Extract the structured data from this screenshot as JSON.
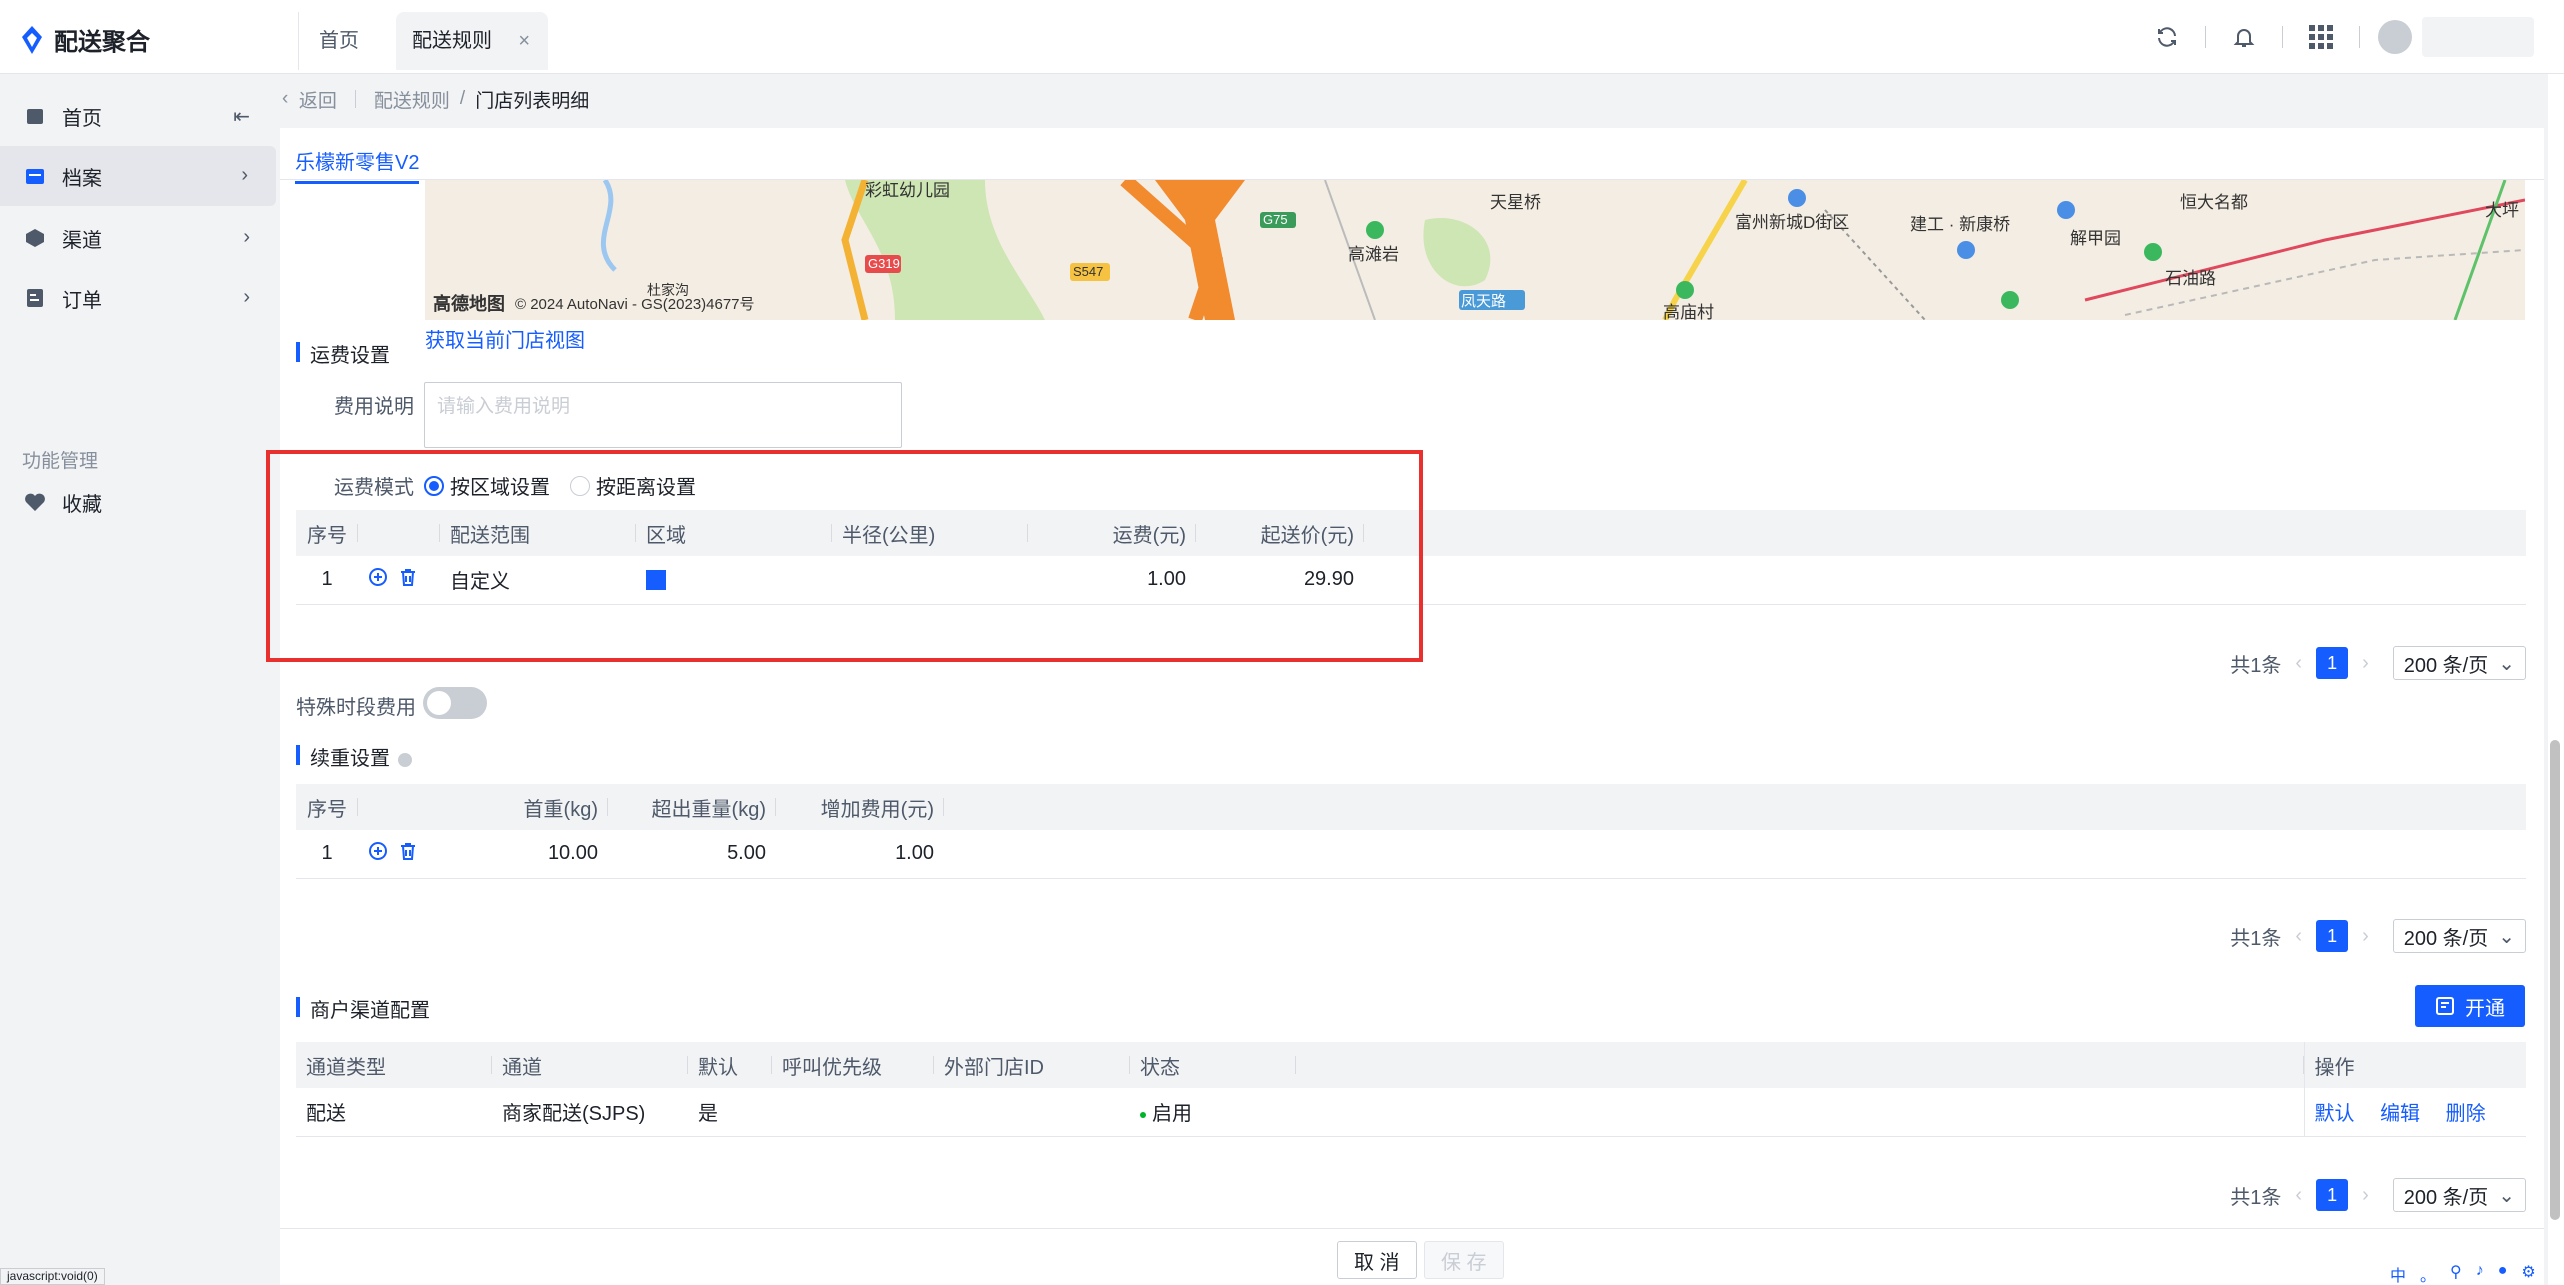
{
  "app": {
    "name": "配送聚合"
  },
  "tabs": {
    "home": "首页",
    "rules": "配送规则",
    "close": "×"
  },
  "sidebar": {
    "items": [
      {
        "label": "首页",
        "collapse": "⇤"
      },
      {
        "label": "档案",
        "arrow": "›"
      },
      {
        "label": "渠道",
        "arrow": "›"
      },
      {
        "label": "订单",
        "arrow": "›"
      }
    ],
    "section": "功能管理",
    "favorites": "收藏"
  },
  "breadcrumb": {
    "back": "返回",
    "parent": "配送规则",
    "slash": "/",
    "current": "门店列表明细"
  },
  "store_tab": "乐檬新零售V2",
  "map": {
    "brand": "高德地图",
    "copyright": "© 2024 AutoNavi - GS(2023)4677号",
    "labels": [
      "彩虹幼儿园",
      "天星桥",
      "富州新城D街区",
      "建工 · 新康桥",
      "恒大名都",
      "大坪",
      "高滩岩",
      "解甲园",
      "石油路",
      "杜家沟",
      "凤天路",
      "高庙村",
      "G319",
      "G75",
      "S547"
    ]
  },
  "view_link": "获取当前门店视图",
  "freight": {
    "title": "运费设置",
    "desc_label": "费用说明",
    "desc_placeholder": "请输入费用说明",
    "mode_label": "运费模式",
    "mode_area": "按区域设置",
    "mode_distance": "按距离设置",
    "columns": [
      "序号",
      "配送范围",
      "区域",
      "半径(公里)",
      "运费(元)",
      "起送价(元)"
    ],
    "rows": [
      {
        "no": "1",
        "range": "自定义",
        "radius": "",
        "fee": "1.00",
        "min": "29.90"
      }
    ],
    "zone_color": "#165dff"
  },
  "pager1": {
    "total": "共1条",
    "page": "1",
    "size": "200 条/页"
  },
  "special": {
    "label": "特殊时段费用",
    "enabled": false
  },
  "weight": {
    "title": "续重设置",
    "columns": [
      "序号",
      "首重(kg)",
      "超出重量(kg)",
      "增加费用(元)"
    ],
    "rows": [
      {
        "no": "1",
        "first": "10.00",
        "over": "5.00",
        "add": "1.00"
      }
    ]
  },
  "pager2": {
    "total": "共1条",
    "page": "1",
    "size": "200 条/页"
  },
  "channel": {
    "title": "商户渠道配置",
    "open_button": "开通",
    "columns": [
      "通道类型",
      "通道",
      "默认",
      "呼叫优先级",
      "外部门店ID",
      "状态",
      "操作"
    ],
    "rows": [
      {
        "type": "配送",
        "channel": "商家配送(SJPS)",
        "default": "是",
        "priority": "",
        "ext_id": "",
        "status": "启用"
      }
    ],
    "actions": [
      "默认",
      "编辑",
      "删除"
    ]
  },
  "pager3": {
    "total": "共1条",
    "page": "1",
    "size": "200 条/页"
  },
  "footer": {
    "cancel": "取 消",
    "save": "保 存"
  },
  "statusbar": "javascript:void(0)",
  "tray": [
    "中",
    "。",
    "⚲",
    "♪",
    "●",
    "⚙"
  ],
  "colors": {
    "accent": "#165dff",
    "highlight": "#e8312f",
    "status_ok": "#00b42a"
  }
}
